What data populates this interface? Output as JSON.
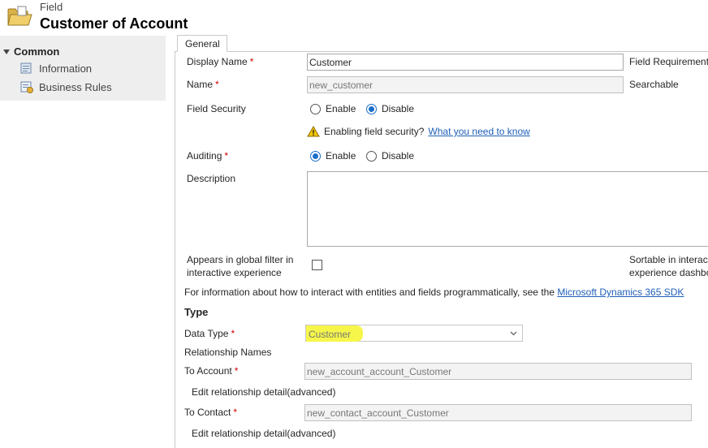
{
  "header": {
    "entity": "Field",
    "title": "Customer of Account"
  },
  "nav": {
    "section": "Common",
    "items": [
      {
        "label": "Information"
      },
      {
        "label": "Business Rules"
      }
    ]
  },
  "tabs": [
    {
      "label": "General"
    }
  ],
  "fields": {
    "display_name": {
      "label": "Display Name",
      "value": "Customer",
      "required": "*"
    },
    "name": {
      "label": "Name",
      "value": "new_customer",
      "required": "*"
    },
    "field_security": {
      "label": "Field Security",
      "options": [
        "Enable",
        "Disable"
      ],
      "selected": "Disable"
    },
    "security_warning": {
      "text": "Enabling field security?",
      "link": "What you need to know"
    },
    "auditing": {
      "label": "Auditing",
      "options": [
        "Enable",
        "Disable"
      ],
      "selected": "Enable",
      "required": "*"
    },
    "description": {
      "label": "Description",
      "value": ""
    },
    "global_filter": {
      "label_line1": "Appears in global filter in",
      "label_line2": "interactive experience",
      "checked": false
    },
    "field_requirement": {
      "label": "Field Requirement"
    },
    "searchable": {
      "label": "Searchable"
    },
    "sortable": {
      "label_line1": "Sortable in interac",
      "label_line2": "experience dashbo"
    }
  },
  "info": {
    "text": "For information about how to interact with entities and fields programmatically, see the",
    "link": "Microsoft Dynamics 365 SDK"
  },
  "type_section": {
    "title": "Type",
    "data_type": {
      "label": "Data Type",
      "value": "Customer",
      "required": "*",
      "highlight_color": "#f6f64a"
    },
    "relationship_names": "Relationship Names",
    "to_account": {
      "label": "To Account",
      "value": "new_account_account_Customer",
      "required": "*"
    },
    "edit_detail_1": "Edit relationship detail(advanced)",
    "to_contact": {
      "label": "To Contact",
      "value": "new_contact_account_Customer",
      "required": "*"
    },
    "edit_detail_2": "Edit relationship detail(advanced)"
  },
  "icons": {
    "header": "folder-icon",
    "nav_info": "information-page-icon",
    "nav_rules": "business-rules-icon",
    "warning": "warning-icon",
    "dropdown": "chevron-down-icon"
  },
  "colors": {
    "required": "#cc0000",
    "link": "#1f5fb8",
    "radio_selected": "#1a6ecb"
  }
}
